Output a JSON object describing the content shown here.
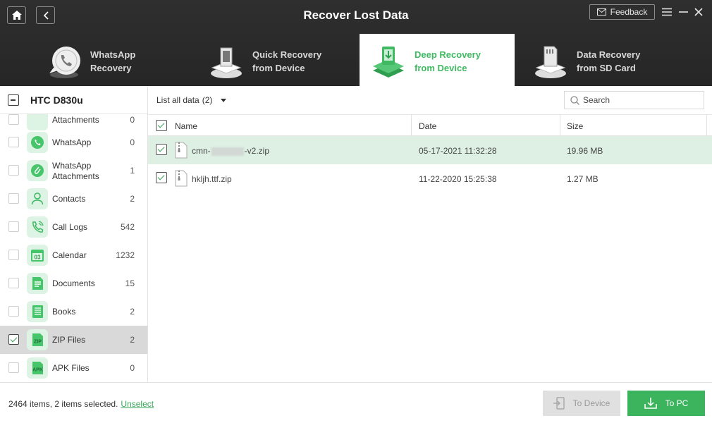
{
  "window": {
    "title": "Recover Lost Data",
    "feedback_label": "Feedback"
  },
  "tabs": [
    {
      "label": "WhatsApp\nRecovery",
      "icon": "whatsapp-phone-icon",
      "active": false
    },
    {
      "label": "Quick Recovery\nfrom Device",
      "icon": "device-scan-icon",
      "active": false
    },
    {
      "label": "Deep Recovery\nfrom Device",
      "icon": "deep-recovery-icon",
      "active": true
    },
    {
      "label": "Data Recovery\nfrom SD Card",
      "icon": "sd-card-icon",
      "active": false
    }
  ],
  "sidebar": {
    "device_name": "HTC D830u",
    "categories": [
      {
        "label": "Attachments",
        "count": "0",
        "icon": "attachment-icon",
        "checked": false
      },
      {
        "label": "WhatsApp",
        "count": "0",
        "icon": "whatsapp-icon",
        "checked": false
      },
      {
        "label": "WhatsApp\nAttachments",
        "count": "1",
        "icon": "whatsapp-attachment-icon",
        "checked": false
      },
      {
        "label": "Contacts",
        "count": "2",
        "icon": "contacts-icon",
        "checked": false
      },
      {
        "label": "Call Logs",
        "count": "542",
        "icon": "call-logs-icon",
        "checked": false
      },
      {
        "label": "Calendar",
        "count": "1232",
        "icon": "calendar-icon",
        "checked": false
      },
      {
        "label": "Documents",
        "count": "15",
        "icon": "documents-icon",
        "checked": false
      },
      {
        "label": "Books",
        "count": "2",
        "icon": "books-icon",
        "checked": false
      },
      {
        "label": "ZIP Files",
        "count": "2",
        "icon": "zip-icon",
        "checked": true
      },
      {
        "label": "APK Files",
        "count": "0",
        "icon": "apk-icon",
        "checked": false
      }
    ]
  },
  "main": {
    "filter_label": "List all data",
    "filter_count": "(2)",
    "search_placeholder": "Search",
    "columns": {
      "name": "Name",
      "date": "Date",
      "size": "Size"
    },
    "files": [
      {
        "name_prefix": "cmn-",
        "name_suffix": "-v2.zip",
        "date": "05-17-2021 11:32:28",
        "size": "19.96 MB",
        "checked": true,
        "highlighted": true
      },
      {
        "name_prefix": "hkljh.ttf.zip",
        "name_suffix": "",
        "date": "11-22-2020 15:25:38",
        "size": "1.27 MB",
        "checked": true,
        "highlighted": false
      }
    ]
  },
  "footer": {
    "status": "2464 items, 2 items selected.",
    "unselect": "Unselect",
    "to_device": "To Device",
    "to_pc": "To PC"
  },
  "colors": {
    "accent": "#3cb45e",
    "header_bg": "#2a2a2a",
    "row_highlight": "#ddf0e3"
  }
}
